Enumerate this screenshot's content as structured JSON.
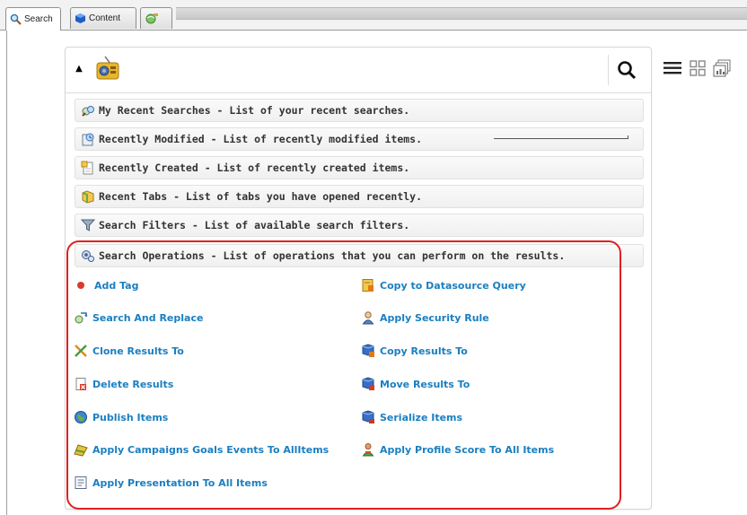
{
  "tabs": [
    {
      "label": "Search",
      "icon": "search-icon",
      "active": true
    },
    {
      "label": "Content",
      "icon": "content-cube-icon",
      "active": false
    },
    {
      "label": "",
      "icon": "globe-icon",
      "active": false
    }
  ],
  "toolbar": {
    "collapse_icon": "caret-up-icon",
    "source_icon": "radio-icon",
    "search_icon": "magnifier-icon"
  },
  "view_icons": [
    "list-view-icon",
    "grid-view-icon",
    "report-view-icon"
  ],
  "sections": [
    {
      "label": "My Recent Searches - List of your recent searches.",
      "icon": "recent-searches-icon"
    },
    {
      "label": "Recently Modified - List of recently modified items.",
      "icon": "recently-modified-icon"
    },
    {
      "label": "Recently Created - List of recently created items.",
      "icon": "recently-created-icon"
    },
    {
      "label": "Recent Tabs - List of tabs you have opened recently.",
      "icon": "recent-tabs-icon"
    },
    {
      "label": "Search Filters - List of available search filters.",
      "icon": "filter-icon"
    },
    {
      "label": "Search Operations - List of operations that you can perform on the results.",
      "icon": "operations-icon"
    }
  ],
  "operations": {
    "left": [
      {
        "label": "Add Tag",
        "icon": "red-dot-icon"
      },
      {
        "label": "Search And Replace",
        "icon": "search-replace-icon"
      },
      {
        "label": "Clone Results To",
        "icon": "clone-icon"
      },
      {
        "label": "Delete Results",
        "icon": "delete-icon"
      },
      {
        "label": "Publish Items",
        "icon": "globe-publish-icon"
      },
      {
        "label": "Apply Campaigns Goals Events To AllItems",
        "icon": "campaign-icon"
      },
      {
        "label": "Apply Presentation To All Items",
        "icon": "presentation-icon"
      }
    ],
    "right": [
      {
        "label": "Copy to Datasource Query",
        "icon": "datasource-icon"
      },
      {
        "label": "Apply Security Rule",
        "icon": "security-user-icon"
      },
      {
        "label": "Copy Results To",
        "icon": "copy-results-icon"
      },
      {
        "label": "Move Results To",
        "icon": "move-results-icon"
      },
      {
        "label": "Serialize Items",
        "icon": "serialize-icon"
      },
      {
        "label": "Apply Profile Score To All Items",
        "icon": "profile-score-icon"
      }
    ]
  },
  "colors": {
    "link": "#1a7fc1",
    "highlight": "#e02020",
    "section_text": "#333333"
  }
}
